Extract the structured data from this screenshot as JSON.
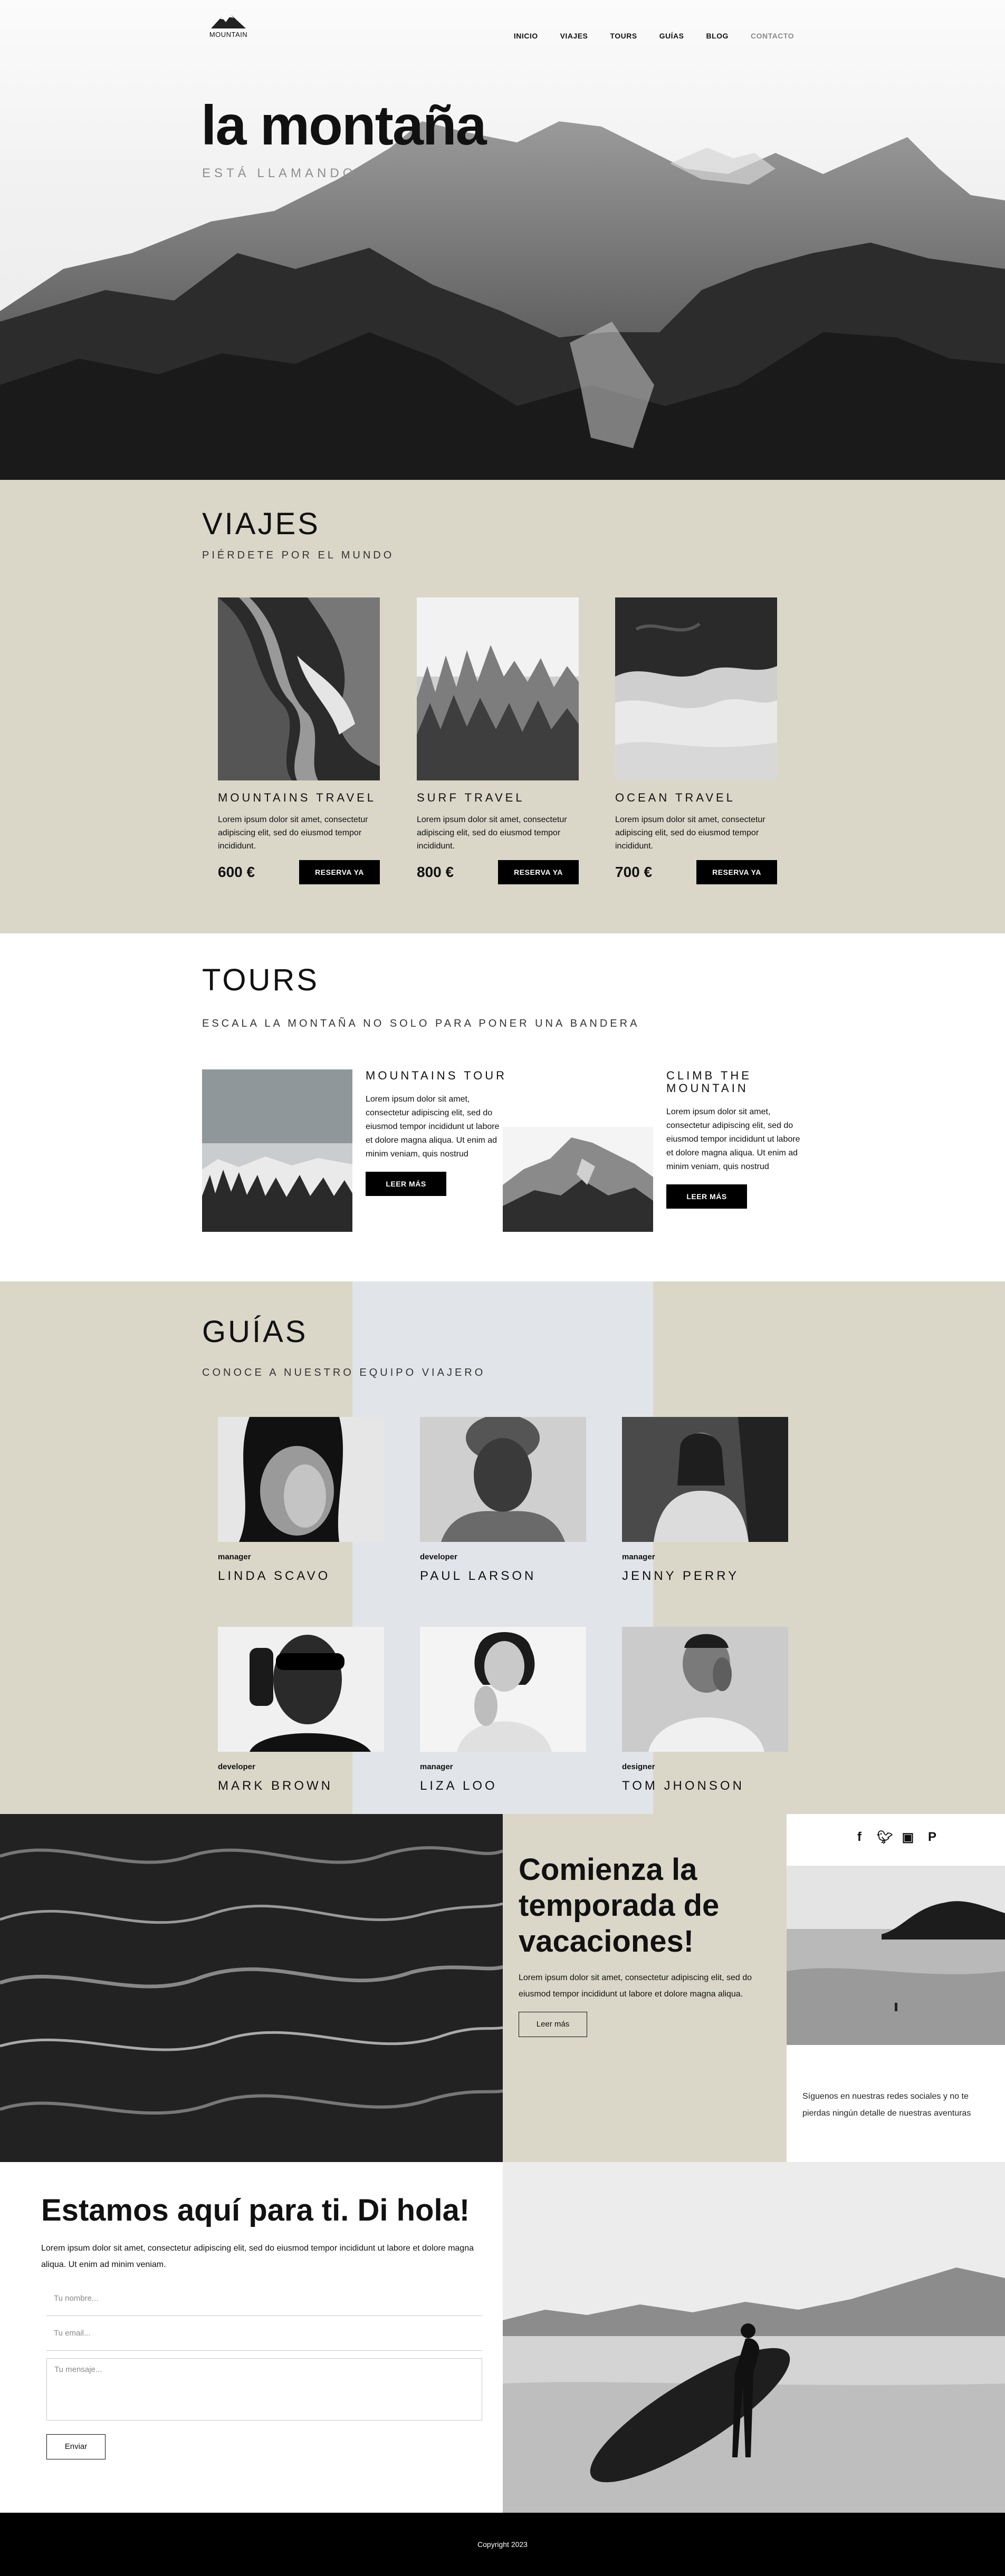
{
  "nav": {
    "logo_text": "MOUNTAIN",
    "items": [
      {
        "label": "INICIO"
      },
      {
        "label": "VIAJES"
      },
      {
        "label": "TOURS"
      },
      {
        "label": "GUÍAS"
      },
      {
        "label": "BLOG"
      },
      {
        "label": "CONTACTO"
      }
    ]
  },
  "hero": {
    "title": "la montaña",
    "subtitle": "ESTÁ LLAMANDO"
  },
  "viajes": {
    "title": "VIAJES",
    "subtitle": "PIÉRDETE POR EL MUNDO",
    "trips": [
      {
        "name": "MOUNTAINS TRAVEL",
        "text": "Lorem ipsum dolor sit amet, consectetur adipiscing elit, sed do eiusmod tempor incididunt.",
        "price": "600 €",
        "button": "RESERVA YA"
      },
      {
        "name": "SURF TRAVEL",
        "text": "Lorem ipsum dolor sit amet, consectetur adipiscing elit, sed do eiusmod tempor incididunt.",
        "price": "800 €",
        "button": "RESERVA YA"
      },
      {
        "name": "OCEAN TRAVEL",
        "text": "Lorem ipsum dolor sit amet, consectetur adipiscing elit, sed do eiusmod tempor incididunt.",
        "price": "700 €",
        "button": "RESERVA YA"
      }
    ]
  },
  "tours": {
    "title": "TOURS",
    "subtitle": "ESCALA LA MONTAÑA NO SOLO PARA PONER UNA BANDERA",
    "items": [
      {
        "name": "MOUNTAINS TOUR",
        "text": "Lorem ipsum dolor sit amet, consectetur adipiscing elit, sed do eiusmod tempor incididunt ut labore et dolore magna aliqua. Ut enim ad minim veniam, quis nostrud",
        "button": "LEER MÁS"
      },
      {
        "name": "CLIMB THE MOUNTAIN",
        "text": "Lorem ipsum dolor sit amet, consectetur adipiscing elit, sed do eiusmod tempor incididunt ut labore et dolore magna aliqua. Ut enim ad minim veniam, quis nostrud",
        "button": "LEER MÁS"
      }
    ]
  },
  "guias": {
    "title": "GUÍAS",
    "subtitle": "CONOCE A NUESTRO EQUIPO VIAJERO",
    "people": [
      {
        "role": "manager",
        "name": "LINDA SCAVO"
      },
      {
        "role": "developer",
        "name": "PAUL LARSON"
      },
      {
        "role": "manager",
        "name": "JENNY PERRY"
      },
      {
        "role": "developer",
        "name": "MARK BROWN"
      },
      {
        "role": "manager",
        "name": "LIZA LOO"
      },
      {
        "role": "designer",
        "name": "TOM JHONSON"
      }
    ]
  },
  "promo": {
    "title": "Comienza la temporada de vacaciones!",
    "text": "Lorem ipsum dolor sit amet, consectetur adipiscing elit, sed do eiusmod tempor incididunt ut labore et dolore magna aliqua.",
    "button": "Leer más",
    "social_icons": [
      "facebook-icon",
      "twitter-icon",
      "instagram-icon",
      "pinterest-icon"
    ],
    "social_text": "Síguenos en nuestras redes sociales y no te pierdas ningún detalle de nuestras aventuras"
  },
  "contact": {
    "title": "Estamos aquí para ti. Di hola!",
    "text": "Lorem ipsum dolor sit amet, consectetur adipiscing elit, sed do eiusmod tempor incididunt ut labore et dolore magna aliqua. Ut enim ad minim veniam.",
    "name_placeholder": "Tu nombre...",
    "email_placeholder": "Tu email...",
    "message_placeholder": "Tu mensaje...",
    "button": "Enviar"
  },
  "footer": {
    "text": "Copyright 2023"
  },
  "colors": {
    "beige": "#dad7c8",
    "light_blue": "#e1e4e8",
    "black": "#000000",
    "muted_nav": "#8a8a8a"
  }
}
